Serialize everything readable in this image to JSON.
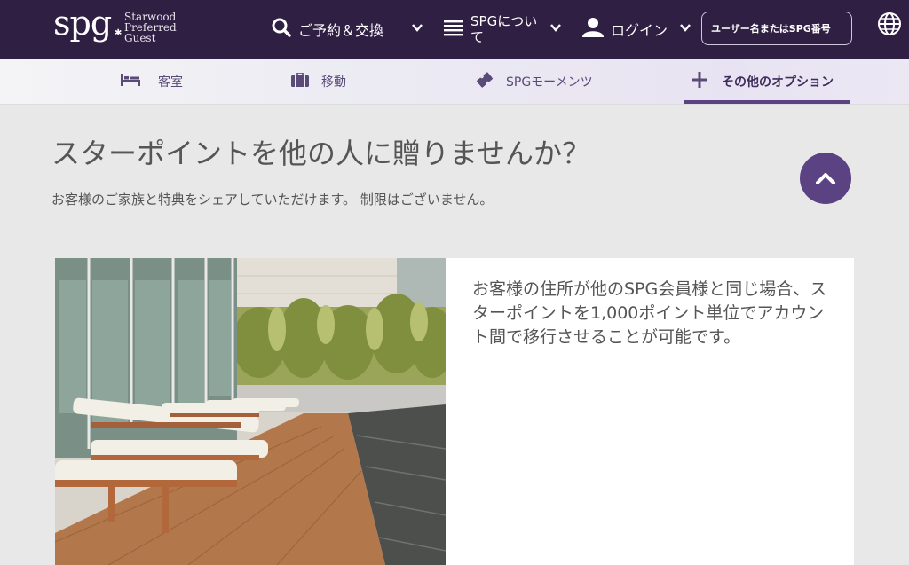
{
  "header": {
    "logo": {
      "mark": "spg",
      "line1": "Starwood",
      "line2": "Preferred",
      "line3": "Guest"
    },
    "nav": [
      {
        "label": "ご予約＆交換",
        "icon": "search-icon"
      },
      {
        "label": "SPGについて",
        "icon": "menu-icon"
      },
      {
        "label": "ログイン",
        "icon": "user-icon"
      }
    ],
    "login_box_label": "ユーザー名またはSPG番号",
    "globe_icon": "globe-icon"
  },
  "subnav": {
    "items": [
      {
        "label": "客室",
        "icon": "bed-icon"
      },
      {
        "label": "移動",
        "icon": "suitcase-icon"
      },
      {
        "label": "SPGモーメンツ",
        "icon": "ticket-icon"
      },
      {
        "label": "その他のオプション",
        "icon": "plus-icon",
        "active": true
      }
    ]
  },
  "main": {
    "title": "スターポイントを他の人に贈りませんか？",
    "subtitle": "お客様のご家族と特典をシェアしていただけます。 制限はございません。",
    "card_text": "お客様の住所が他のSPG会員様と同じ場合、スターポイントを1,000ポイント単位でアカウント間で移行させることが可能です。"
  },
  "colors": {
    "header_bg": "#2f1f43",
    "accent": "#5b4383"
  }
}
